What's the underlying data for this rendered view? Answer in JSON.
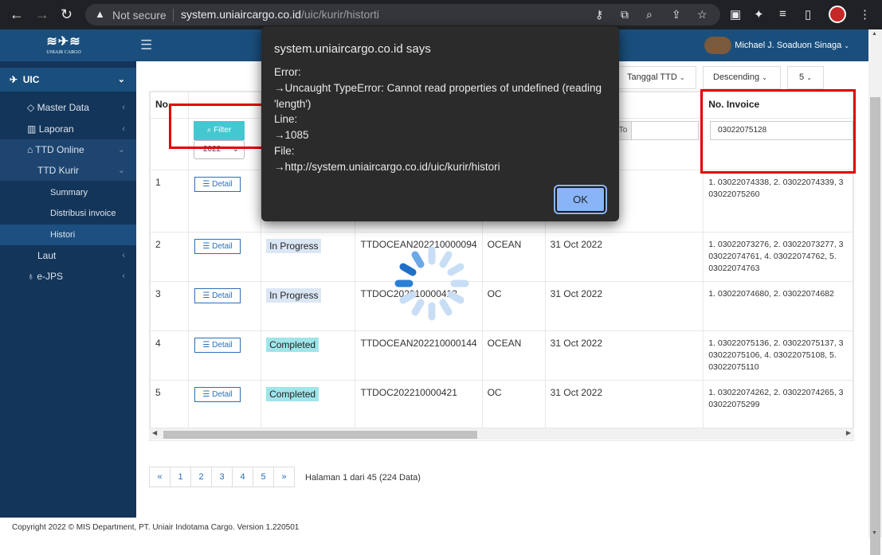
{
  "browser": {
    "security": "Not secure",
    "host": "system.uniaircargo.co.id",
    "path": "/uic/kurir/historti"
  },
  "header": {
    "logo_text": "UNIAIR CARGO",
    "user_name": "Michael J. Soaduon Sinaga"
  },
  "sidebar": {
    "items": [
      {
        "label": "UIC"
      },
      {
        "label": "Master Data"
      },
      {
        "label": "Laporan"
      },
      {
        "label": "TTD Online"
      },
      {
        "label": "TTD Kurir"
      },
      {
        "label": "Summary"
      },
      {
        "label": "Distribusi invoice"
      },
      {
        "label": "Histori"
      },
      {
        "label": "Laut"
      },
      {
        "label": "e-JPS"
      }
    ]
  },
  "toolbar": {
    "sort_field": "Tanggal TTD",
    "sort_order": "Descending",
    "page_size": "5"
  },
  "table": {
    "col_no": "No.",
    "col_invoice": "No. Invoice",
    "filter_label": "Filter",
    "year_value": "2022",
    "to_label": "To",
    "invoice_filter_value": "03022075128",
    "detail_label": "Detail",
    "rows": [
      {
        "no": "1",
        "status": "",
        "ttd": "",
        "type": "",
        "date": "",
        "invoice_1": "1. 03022074338, 2. 03022074339, 3",
        "invoice_2": "03022075260",
        "invoice_3": ""
      },
      {
        "no": "2",
        "status": "In Progress",
        "ttd": "TTDOCEAN202210000094",
        "type": "OCEAN",
        "date": "31 Oct 2022",
        "invoice_1": "1. 03022073276, 2. 03022073277, 3",
        "invoice_2": "03022074761, 4. 03022074762, 5.",
        "invoice_3": "03022074763"
      },
      {
        "no": "3",
        "status": "In Progress",
        "ttd": "TTDOC202210000413",
        "type": "OC",
        "date": "31 Oct 2022",
        "invoice_1": "1. 03022074680, 2. 03022074682",
        "invoice_2": "",
        "invoice_3": ""
      },
      {
        "no": "4",
        "status": "Completed",
        "ttd": "TTDOCEAN202210000144",
        "type": "OCEAN",
        "date": "31 Oct 2022",
        "invoice_1": "1. 03022075136, 2. 03022075137, 3",
        "invoice_2": "03022075106, 4. 03022075108, 5.",
        "invoice_3": "03022075110"
      },
      {
        "no": "5",
        "status": "Completed",
        "ttd": "TTDOC202210000421",
        "type": "OC",
        "date": "31 Oct 2022",
        "invoice_1": "1. 03022074262, 2. 03022074265, 3",
        "invoice_2": "03022075299",
        "invoice_3": ""
      }
    ]
  },
  "pagination": {
    "prev": "«",
    "pages": [
      "1",
      "2",
      "3",
      "4",
      "5"
    ],
    "next": "»",
    "info": "Halaman 1 dari 45 (224 Data)"
  },
  "footer": {
    "text": "Copyright 2022 © MIS Department, PT. Uniair Indotama Cargo. Version 1.220501"
  },
  "dialog": {
    "title": "system.uniaircargo.co.id says",
    "message": "Error:\n→Uncaught TypeError: Cannot read properties of undefined (reading 'length')\nLine:\n→1085\nFile:\n→http://system.uniaircargo.co.id/uic/kurir/histori",
    "ok_label": "OK"
  },
  "colors": {
    "topbar": "#1a4f7d",
    "sidebar": "#14355a",
    "accent": "#45c7d2",
    "highlight": "#e30000"
  }
}
